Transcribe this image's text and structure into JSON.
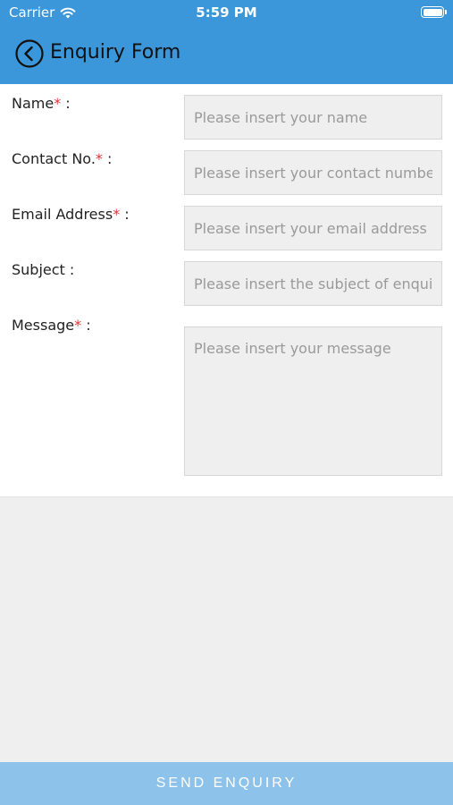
{
  "status_bar": {
    "carrier": "Carrier",
    "time": "5:59 PM"
  },
  "nav": {
    "title": "Enquiry Form"
  },
  "form": {
    "fields": [
      {
        "label": "Name",
        "required": true,
        "suffix": " :",
        "placeholder": "Please insert your name",
        "value": ""
      },
      {
        "label": "Contact No.",
        "required": true,
        "suffix": " :",
        "placeholder": "Please insert your contact number",
        "value": ""
      },
      {
        "label": "Email Address",
        "required": true,
        "suffix": " :",
        "placeholder": "Please insert your email address",
        "value": ""
      },
      {
        "label": "Subject",
        "required": false,
        "suffix": " :",
        "placeholder": "Please insert the subject of enquiry",
        "value": ""
      },
      {
        "label": "Message",
        "required": true,
        "suffix": " :",
        "placeholder": "Please insert your message",
        "value": ""
      }
    ],
    "required_marker": "*"
  },
  "footer": {
    "send_label": "SEND ENQUIRY"
  },
  "colors": {
    "header": "#3b97d9",
    "required": "#e23232",
    "send_button": "#8dc3ea"
  }
}
